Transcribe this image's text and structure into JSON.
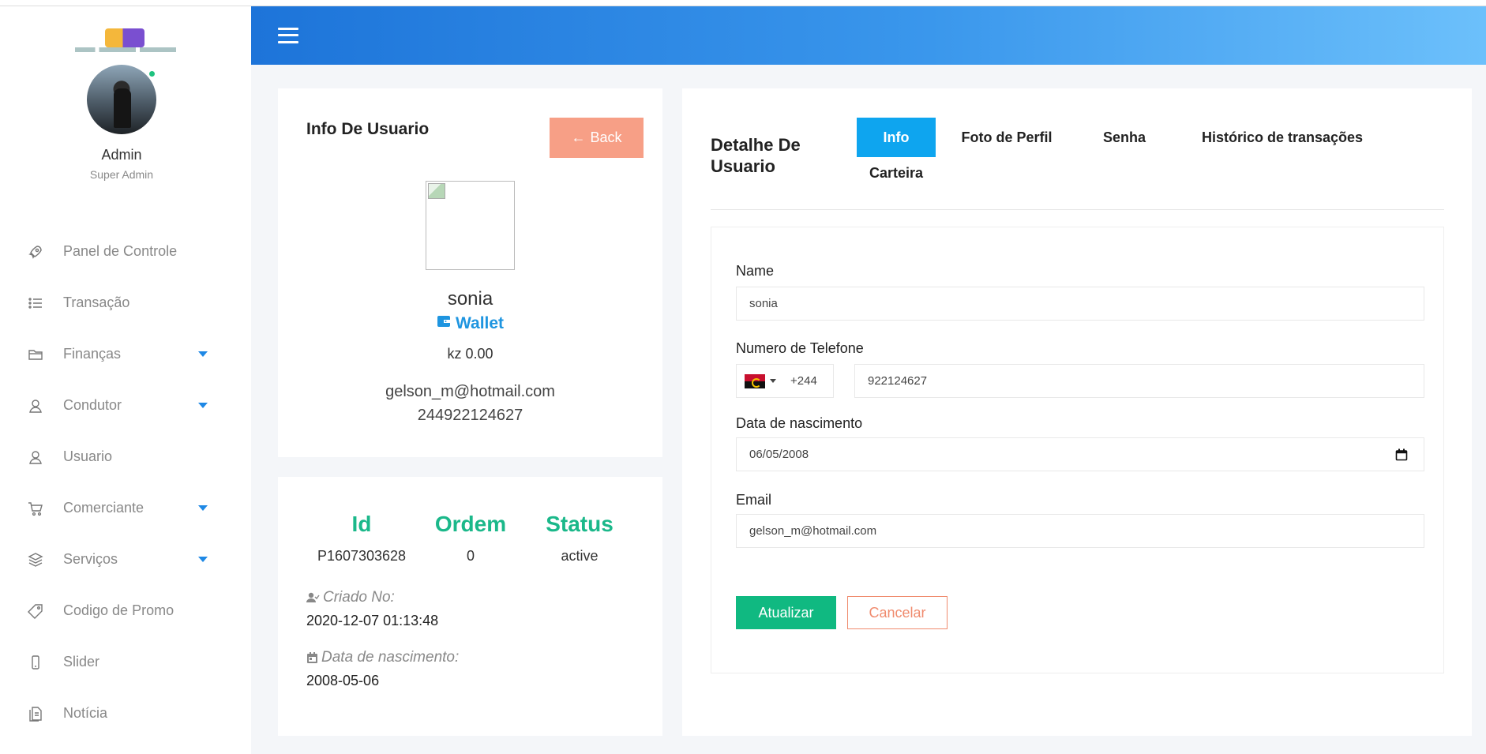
{
  "sidebar": {
    "admin_name": "Admin",
    "admin_role": "Super Admin",
    "items": [
      {
        "label": "Panel de Controle",
        "icon": "rocket-icon",
        "submenu": false
      },
      {
        "label": "Transação",
        "icon": "list-icon",
        "submenu": false
      },
      {
        "label": "Finanças",
        "icon": "folder-icon",
        "submenu": true
      },
      {
        "label": "Condutor",
        "icon": "user-icon",
        "submenu": true
      },
      {
        "label": "Usuario",
        "icon": "user-icon",
        "submenu": false
      },
      {
        "label": "Comerciante",
        "icon": "cart-icon",
        "submenu": true
      },
      {
        "label": "Serviços",
        "icon": "layers-icon",
        "submenu": true
      },
      {
        "label": "Codigo de Promo",
        "icon": "tag-icon",
        "submenu": false
      },
      {
        "label": "Slider",
        "icon": "mobile-icon",
        "submenu": false
      },
      {
        "label": "Notícia",
        "icon": "document-icon",
        "submenu": false
      }
    ]
  },
  "user_info": {
    "title": "Info De Usuario",
    "back_label": "Back",
    "name": "sonia",
    "wallet_label": "Wallet",
    "balance": "kz 0.00",
    "email": "gelson_m@hotmail.com",
    "phone": "244922124627"
  },
  "stats": {
    "id_label": "Id",
    "id_value": "P1607303628",
    "order_label": "Ordem",
    "order_value": "0",
    "status_label": "Status",
    "status_value": "active",
    "created_label": "Criado No:",
    "created_value": "2020-12-07 01:13:48",
    "dob_label": "Data de nascimento:",
    "dob_value": "2008-05-06"
  },
  "detail": {
    "title": "Detalhe De Usuario",
    "tabs": [
      {
        "label": "Info",
        "active": true
      },
      {
        "label": "Foto de Perfil",
        "active": false
      },
      {
        "label": "Senha",
        "active": false
      },
      {
        "label": "Histórico de transações",
        "active": false
      },
      {
        "label": "Carteira",
        "active": false
      }
    ]
  },
  "form": {
    "name_label": "Name",
    "name_value": "sonia",
    "phone_label": "Numero de Telefone",
    "phone_code": "+244",
    "phone_value": "922124627",
    "dob_label": "Data de nascimento",
    "dob_value": "06/05/2008",
    "email_label": "Email",
    "email_value": "gelson_m@hotmail.com",
    "update_label": "Atualizar",
    "cancel_label": "Cancelar"
  },
  "colors": {
    "accent": "#1e88e5",
    "tab_active": "#0ea5ef",
    "success": "#10b981",
    "back_button": "#f79f86",
    "stat_green": "#1bb88a"
  }
}
